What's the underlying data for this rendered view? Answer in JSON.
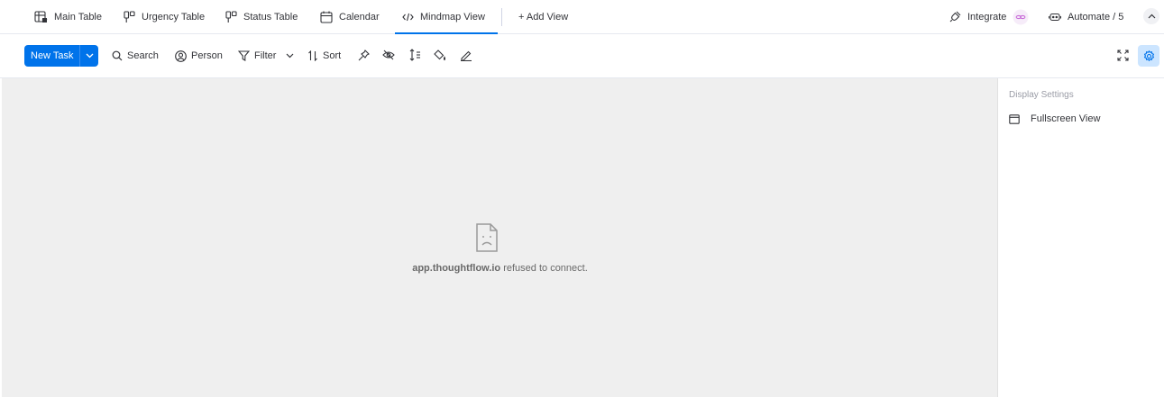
{
  "views": {
    "tabs": [
      {
        "label": "Main Table",
        "icon": "table-icon"
      },
      {
        "label": "Urgency Table",
        "icon": "kanban-icon"
      },
      {
        "label": "Status Table",
        "icon": "kanban-icon"
      },
      {
        "label": "Calendar",
        "icon": "calendar-icon"
      },
      {
        "label": "Mindmap View",
        "icon": "code-icon",
        "active": true
      }
    ],
    "add_view": "+ Add View",
    "integrate": "Integrate",
    "automate": "Automate / 5"
  },
  "toolbar": {
    "new_task": "New Task",
    "search": "Search",
    "person": "Person",
    "filter": "Filter",
    "sort": "Sort"
  },
  "content": {
    "error_host": "app.thoughtflow.io",
    "error_message": " refused to connect."
  },
  "side_panel": {
    "title": "Display Settings",
    "fullscreen_label": "Fullscreen View"
  },
  "colors": {
    "accent": "#0073ea",
    "content_bg": "#efefef",
    "integrate_badge": "#c86bd8"
  }
}
